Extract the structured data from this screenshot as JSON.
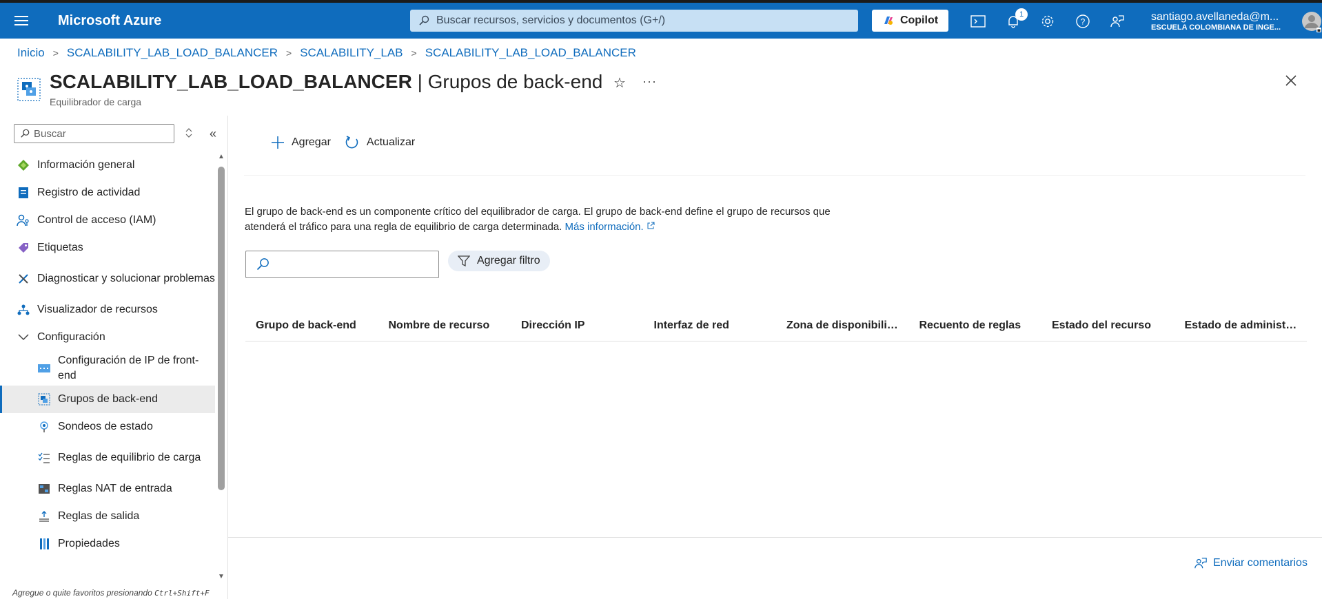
{
  "topbar": {
    "brand": "Microsoft Azure",
    "search_placeholder": "Buscar recursos, servicios y documentos (G+/)",
    "copilot_label": "Copilot",
    "notification_count": "1",
    "account_name": "santiago.avellaneda@m...",
    "account_org": "ESCUELA COLOMBIANA DE INGE..."
  },
  "breadcrumb": {
    "items": [
      "Inicio",
      "SCALABILITY_LAB_LOAD_BALANCER",
      "SCALABILITY_LAB",
      "SCALABILITY_LAB_LOAD_BALANCER"
    ]
  },
  "header": {
    "resource_name": "SCALABILITY_LAB_LOAD_BALANCER",
    "page_name": " | Grupos de back-end",
    "subtitle": "Equilibrador de carga",
    "more_label": "···"
  },
  "nav": {
    "search_placeholder": "Buscar",
    "items": [
      {
        "label": "Información general",
        "icon": "overview-icon"
      },
      {
        "label": "Registro de actividad",
        "icon": "activity-log-icon"
      },
      {
        "label": "Control de acceso (IAM)",
        "icon": "iam-icon"
      },
      {
        "label": "Etiquetas",
        "icon": "tag-icon"
      },
      {
        "label": "Diagnosticar y solucionar problemas",
        "icon": "wrench-icon"
      },
      {
        "label": "Visualizador de recursos",
        "icon": "resource-visualizer-icon"
      },
      {
        "label": "Configuración",
        "icon": "chevron-down-icon"
      },
      {
        "label": "Configuración de IP de front-end",
        "icon": "frontend-ip-icon"
      },
      {
        "label": "Grupos de back-end",
        "icon": "backend-pool-icon"
      },
      {
        "label": "Sondeos de estado",
        "icon": "health-probe-icon"
      },
      {
        "label": "Reglas de equilibrio de carga",
        "icon": "lb-rules-icon"
      },
      {
        "label": "Reglas NAT de entrada",
        "icon": "nat-rules-icon"
      },
      {
        "label": "Reglas de salida",
        "icon": "outbound-rules-icon"
      },
      {
        "label": "Propiedades",
        "icon": "properties-icon"
      }
    ],
    "fav_hint_prefix": "Agregue o quite favoritos presionando ",
    "fav_hint_keys": "Ctrl+Shift+F"
  },
  "toolbar": {
    "add_label": "Agregar",
    "refresh_label": "Actualizar"
  },
  "content": {
    "description": "El grupo de back-end es un componente crítico del equilibrador de carga. El grupo de back-end define el grupo de recursos que atenderá el tráfico para una regla de equilibrio de carga determinada.",
    "learn_more": "Más información.",
    "add_filter_label": "Agregar filtro"
  },
  "table": {
    "columns": [
      "Grupo de back-end",
      "Nombre de recurso",
      "Dirección IP",
      "Interfaz de red",
      "Zona de disponibilidad",
      "Recuento de reglas",
      "Estado del recurso",
      "Estado de administración"
    ],
    "rows": []
  },
  "footer": {
    "feedback_label": "Enviar comentarios"
  },
  "colors": {
    "accent": "#0f6cbd",
    "selected_bg": "#ebebeb"
  }
}
